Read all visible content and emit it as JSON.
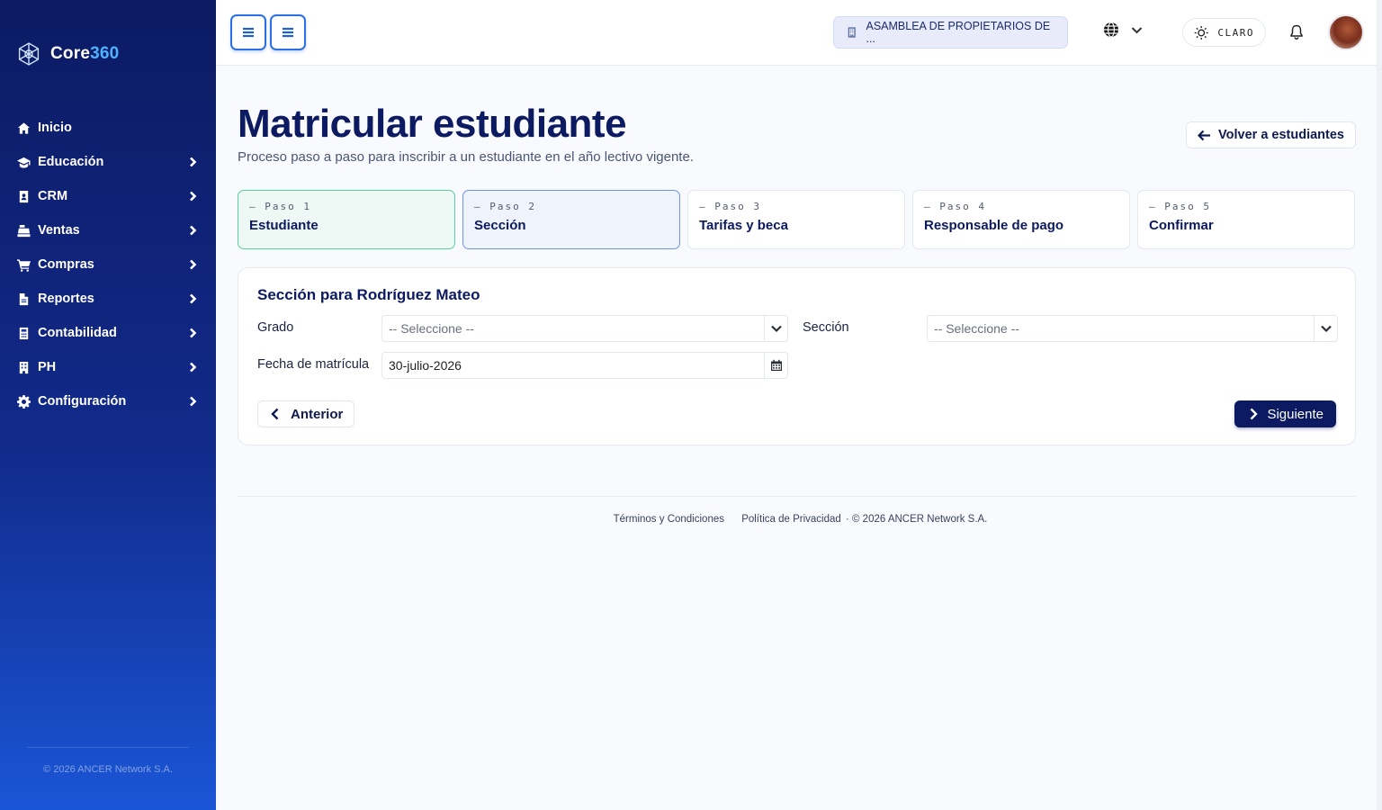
{
  "brand": {
    "name_main": "Core",
    "name_accent": "360"
  },
  "sidebar": {
    "items": [
      {
        "label": "Inicio",
        "icon": "home-icon",
        "has_children": false
      },
      {
        "label": "Educación",
        "icon": "graduation-cap-icon",
        "has_children": true
      },
      {
        "label": "CRM",
        "icon": "address-book-icon",
        "has_children": true
      },
      {
        "label": "Ventas",
        "icon": "cash-register-icon",
        "has_children": true
      },
      {
        "label": "Compras",
        "icon": "cart-icon",
        "has_children": true
      },
      {
        "label": "Reportes",
        "icon": "file-icon",
        "has_children": true
      },
      {
        "label": "Contabilidad",
        "icon": "calculator-icon",
        "has_children": true
      },
      {
        "label": "PH",
        "icon": "building-icon",
        "has_children": true
      },
      {
        "label": "Configuración",
        "icon": "gear-icon",
        "has_children": true
      }
    ],
    "footer": "© 2026 ANCER Network S.A."
  },
  "topbar": {
    "organization": "ASAMBLEA DE PROPIETARIOS DE ...",
    "theme_label": "CLARO"
  },
  "page": {
    "title": "Matricular estudiante",
    "subtitle": "Proceso paso a paso para inscribir a un estudiante en el año lectivo vigente.",
    "back_label": "Volver a estudiantes"
  },
  "steps": [
    {
      "num": "— Paso 1",
      "name": "Estudiante",
      "state": "done"
    },
    {
      "num": "— Paso 2",
      "name": "Sección",
      "state": "active"
    },
    {
      "num": "— Paso 3",
      "name": "Tarifas y beca",
      "state": "pending"
    },
    {
      "num": "— Paso 4",
      "name": "Responsable de pago",
      "state": "pending"
    },
    {
      "num": "— Paso 5",
      "name": "Confirmar",
      "state": "pending"
    }
  ],
  "form": {
    "title": "Sección para Rodríguez Mateo",
    "grado_label": "Grado",
    "grado_value": "-- Seleccione --",
    "seccion_label": "Sección",
    "seccion_value": "-- Seleccione --",
    "fecha_label": "Fecha de matrícula",
    "fecha_value": "30-julio-2026",
    "prev_label": "Anterior",
    "next_label": "Siguiente"
  },
  "footer": {
    "terms": "Términos y Condiciones",
    "privacy": "Política de Privacidad",
    "copyright": "· © 2026 ANCER Network S.A."
  },
  "colors": {
    "primary": "#0c1a62",
    "accent": "#2a6ee8",
    "success": "#5bcf9f"
  }
}
